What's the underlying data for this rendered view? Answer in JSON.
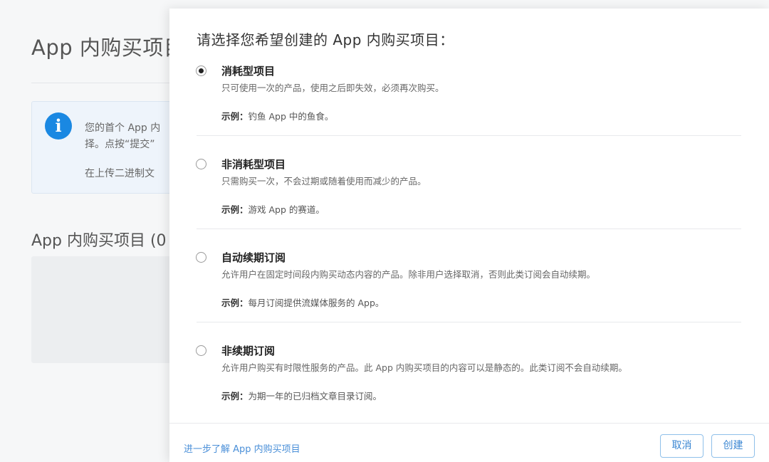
{
  "background": {
    "title": "App 内购买项目",
    "info": {
      "line1": "您的首个 App 内",
      "line2": "择。点按“提交”",
      "line3": "在上传二进制文"
    },
    "section_title": "App 内购买项目 (0"
  },
  "modal": {
    "title": "请选择您希望创建的 App 内购买项目：",
    "example_label": "示例：",
    "options": [
      {
        "title": "消耗型项目",
        "description": "只可使用一次的产品，使用之后即失效，必须再次购买。",
        "example": "钓鱼 App 中的鱼食。",
        "selected": true
      },
      {
        "title": "非消耗型项目",
        "description": "只需购买一次，不会过期或随着使用而减少的产品。",
        "example": "游戏 App 的赛道。",
        "selected": false
      },
      {
        "title": "自动续期订阅",
        "description": "允许用户在固定时间段内购买动态内容的产品。除非用户选择取消，否则此类订阅会自动续期。",
        "example": "每月订阅提供流媒体服务的 App。",
        "selected": false
      },
      {
        "title": "非续期订阅",
        "description": "允许用户购买有时限性服务的产品。此 App 内购买项目的内容可以是静态的。此类订阅不会自动续期。",
        "example": "为期一年的已归档文章目录订阅。",
        "selected": false
      }
    ],
    "footer": {
      "learn_more": "进一步了解 App 内购买项目",
      "cancel": "取消",
      "create": "创建"
    }
  },
  "colors": {
    "accent": "#3a86d2",
    "info_icon": "#1a88e2"
  },
  "icons": {
    "info": "info-icon"
  }
}
